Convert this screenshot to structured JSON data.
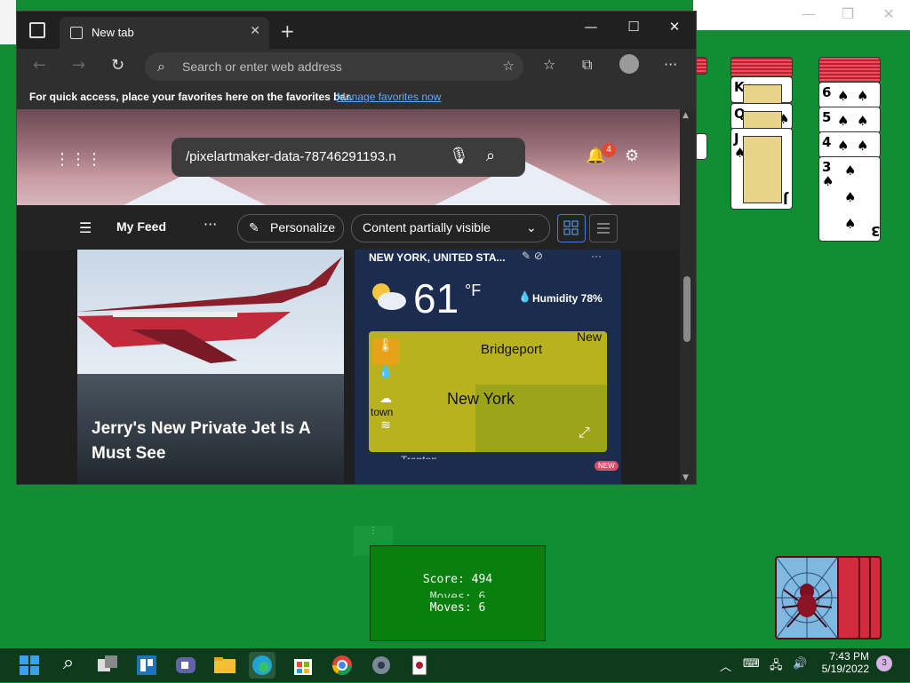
{
  "browser": {
    "tab_title": "New tab",
    "tab_close": "✕",
    "new_tab": "+",
    "window_controls": {
      "minimize": "—",
      "maximize": "☐",
      "close": "✕"
    },
    "nav": {
      "back": "←",
      "forward": "→",
      "refresh": "↻"
    },
    "address_placeholder": "Search or enter web address",
    "favorites_message": "For quick access, place your favorites here on the favorites bar.",
    "favorites_link": "Manage favorites now",
    "more_menu": "···"
  },
  "newtab": {
    "search_query": "/pixelartmaker-data-78746291193.n",
    "notification_count": "4",
    "feed_label": "My Feed",
    "feed_more": "···",
    "personalize_label": "Personalize",
    "visibility_label": "Content partially visible",
    "news_headline": "Jerry's New Private Jet Is A Must See",
    "weather": {
      "location": "NEW YORK, UNITED STA...",
      "temperature": "61",
      "unit": "°F",
      "humidity": "Humidity 78%",
      "map_labels": {
        "bridgeport": "Bridgeport",
        "newyork": "New York",
        "new": "New",
        "town": "town",
        "trenton": "Trenton"
      }
    },
    "new_badge": "NEW"
  },
  "solitaire": {
    "score_label": "Score:",
    "score_value": "494",
    "moves_label": "Moves:",
    "moves_value": "6",
    "column1_cards": [
      {
        "rank": "K",
        "suit": "♠"
      },
      {
        "rank": "Q",
        "suit": "♠"
      },
      {
        "rank": "J",
        "suit": "♠"
      }
    ],
    "column2_cards": [
      {
        "rank": "6",
        "suit": "♠"
      },
      {
        "rank": "5",
        "suit": "♠"
      },
      {
        "rank": "4",
        "suit": "♠"
      },
      {
        "rank": "3",
        "suit": "♠"
      }
    ]
  },
  "taskbar": {
    "time": "7:43 PM",
    "date": "5/19/2022",
    "notification_count": "3"
  },
  "colors": {
    "felt_green": "#118d33",
    "card_back_red": "#d62b3b",
    "edge_link_blue": "#5ea9ff",
    "taskbar": "#0f3b1d"
  }
}
